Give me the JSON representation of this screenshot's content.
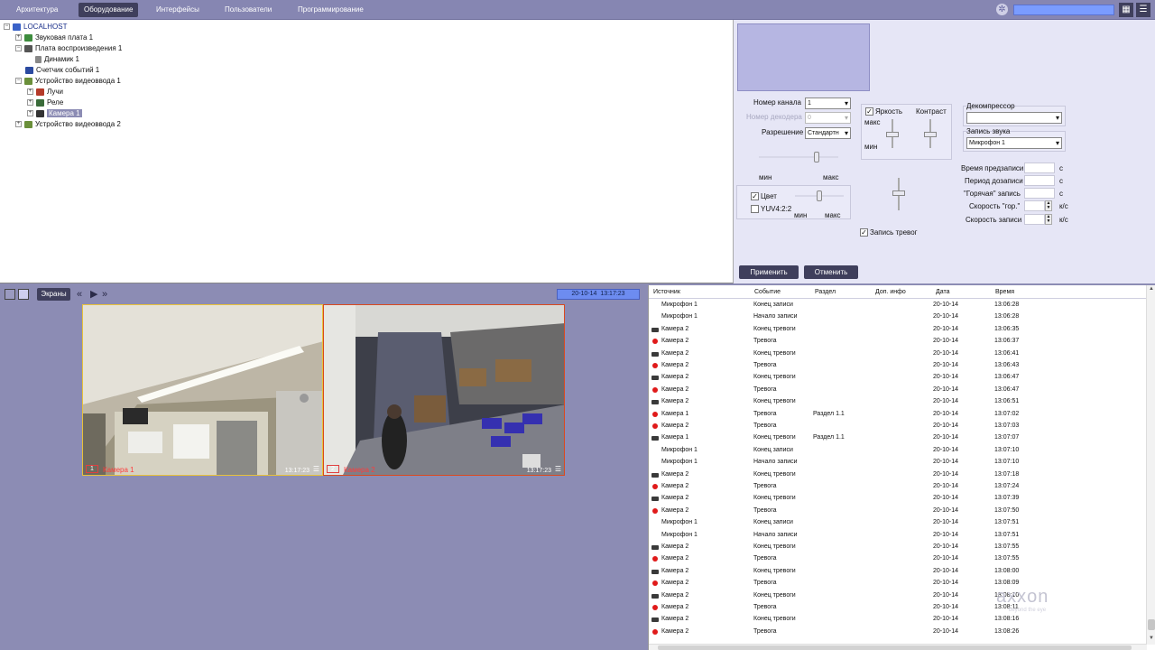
{
  "menu": {
    "tabs": [
      {
        "label": "Архитектура",
        "active": false
      },
      {
        "label": "Оборудование",
        "active": true
      },
      {
        "label": "Интерфейсы",
        "active": false
      },
      {
        "label": "Пользователи",
        "active": false
      },
      {
        "label": "Программирование",
        "active": false
      }
    ]
  },
  "tree": {
    "root": "LOCALHOST",
    "sound_card": "Звуковая плата 1",
    "playback_card": "Плата воспроизведения 1",
    "speaker": "Динамик 1",
    "event_counter": "Счетчик событий 1",
    "video_device_1": "Устройство видеоввода 1",
    "rays": "Лучи",
    "relay": "Реле",
    "camera": "Камера 1",
    "video_device_2": "Устройство видеоввода 2"
  },
  "settings": {
    "channel_label": "Номер канала",
    "channel_value": "1",
    "decoder_label": "Номер декодера",
    "decoder_value": "0",
    "resolution_label": "Разрешение",
    "resolution_value": "Стандартн",
    "min": "мин",
    "max": "макс",
    "brightness": "Яркость",
    "contrast": "Контраст",
    "color_label": "Цвет",
    "yuv_label": "YUV4:2:2",
    "alarm_record": "Запись тревог",
    "decompressor_label": "Декомпрессор",
    "decompressor_value": "",
    "sound_record_label": "Запись звука",
    "sound_record_value": "Микрофон 1",
    "prerecord_label": "Время предзаписи",
    "postrecord_label": "Период дозаписи",
    "hot_record_label": "\"Горячая\" запись",
    "hot_speed_label": "Скорость \"гор.\"",
    "record_speed_label": "Скорость записи",
    "unit_s": "с",
    "unit_fps": "к/с",
    "apply": "Применить",
    "cancel": "Отменить"
  },
  "layout_bar": {
    "screens": "Экраны",
    "date": "20-10-14",
    "time": "13:17:23"
  },
  "cameras": [
    {
      "num": "1",
      "name": "Камера 1",
      "time": "13:17:23",
      "border": "#e8c23a"
    },
    {
      "num": "2",
      "name": "Камера 2",
      "time": "13:17:23",
      "border": "#d94a1f"
    }
  ],
  "events": {
    "columns": [
      "Источник",
      "Событие",
      "Раздел",
      "Доп. инфо",
      "Дата",
      "Время"
    ],
    "rows": [
      {
        "icon": "none",
        "source": "Микрофон 1",
        "event": "Конец записи",
        "section": "",
        "date": "20-10-14",
        "time": "13:06:28"
      },
      {
        "icon": "none",
        "source": "Микрофон 1",
        "event": "Начало записи",
        "section": "",
        "date": "20-10-14",
        "time": "13:06:28"
      },
      {
        "icon": "camera",
        "source": "Камера 2",
        "event": "Конец тревоги",
        "section": "",
        "date": "20-10-14",
        "time": "13:06:35"
      },
      {
        "icon": "alarm",
        "source": "Камера 2",
        "event": "Тревога",
        "section": "",
        "date": "20-10-14",
        "time": "13:06:37"
      },
      {
        "icon": "camera",
        "source": "Камера 2",
        "event": "Конец тревоги",
        "section": "",
        "date": "20-10-14",
        "time": "13:06:41"
      },
      {
        "icon": "alarm",
        "source": "Камера 2",
        "event": "Тревога",
        "section": "",
        "date": "20-10-14",
        "time": "13:06:43"
      },
      {
        "icon": "camera",
        "source": "Камера 2",
        "event": "Конец тревоги",
        "section": "",
        "date": "20-10-14",
        "time": "13:06:47"
      },
      {
        "icon": "alarm",
        "source": "Камера 2",
        "event": "Тревога",
        "section": "",
        "date": "20-10-14",
        "time": "13:06:47"
      },
      {
        "icon": "camera",
        "source": "Камера 2",
        "event": "Конец тревоги",
        "section": "",
        "date": "20-10-14",
        "time": "13:06:51"
      },
      {
        "icon": "alarm",
        "source": "Камера 1",
        "event": "Тревога",
        "section": "Раздел 1.1",
        "date": "20-10-14",
        "time": "13:07:02"
      },
      {
        "icon": "alarm",
        "source": "Камера 2",
        "event": "Тревога",
        "section": "",
        "date": "20-10-14",
        "time": "13:07:03"
      },
      {
        "icon": "camera",
        "source": "Камера 1",
        "event": "Конец тревоги",
        "section": "Раздел 1.1",
        "date": "20-10-14",
        "time": "13:07:07"
      },
      {
        "icon": "none",
        "source": "Микрофон 1",
        "event": "Конец записи",
        "section": "",
        "date": "20-10-14",
        "time": "13:07:10"
      },
      {
        "icon": "none",
        "source": "Микрофон 1",
        "event": "Начало записи",
        "section": "",
        "date": "20-10-14",
        "time": "13:07:10"
      },
      {
        "icon": "camera",
        "source": "Камера 2",
        "event": "Конец тревоги",
        "section": "",
        "date": "20-10-14",
        "time": "13:07:18"
      },
      {
        "icon": "alarm",
        "source": "Камера 2",
        "event": "Тревога",
        "section": "",
        "date": "20-10-14",
        "time": "13:07:24"
      },
      {
        "icon": "camera",
        "source": "Камера 2",
        "event": "Конец тревоги",
        "section": "",
        "date": "20-10-14",
        "time": "13:07:39"
      },
      {
        "icon": "alarm",
        "source": "Камера 2",
        "event": "Тревога",
        "section": "",
        "date": "20-10-14",
        "time": "13:07:50"
      },
      {
        "icon": "none",
        "source": "Микрофон 1",
        "event": "Конец записи",
        "section": "",
        "date": "20-10-14",
        "time": "13:07:51"
      },
      {
        "icon": "none",
        "source": "Микрофон 1",
        "event": "Начало записи",
        "section": "",
        "date": "20-10-14",
        "time": "13:07:51"
      },
      {
        "icon": "camera",
        "source": "Камера 2",
        "event": "Конец тревоги",
        "section": "",
        "date": "20-10-14",
        "time": "13:07:55"
      },
      {
        "icon": "alarm",
        "source": "Камера 2",
        "event": "Тревога",
        "section": "",
        "date": "20-10-14",
        "time": "13:07:55"
      },
      {
        "icon": "camera",
        "source": "Камера 2",
        "event": "Конец тревоги",
        "section": "",
        "date": "20-10-14",
        "time": "13:08:00"
      },
      {
        "icon": "alarm",
        "source": "Камера 2",
        "event": "Тревога",
        "section": "",
        "date": "20-10-14",
        "time": "13:08:09"
      },
      {
        "icon": "camera",
        "source": "Камера 2",
        "event": "Конец тревоги",
        "section": "",
        "date": "20-10-14",
        "time": "13:08:10"
      },
      {
        "icon": "alarm",
        "source": "Камера 2",
        "event": "Тревога",
        "section": "",
        "date": "20-10-14",
        "time": "13:08:11"
      },
      {
        "icon": "camera",
        "source": "Камера 2",
        "event": "Конец тревоги",
        "section": "",
        "date": "20-10-14",
        "time": "13:08:16"
      },
      {
        "icon": "alarm",
        "source": "Камера 2",
        "event": "Тревога",
        "section": "",
        "date": "20-10-14",
        "time": "13:08:26"
      }
    ]
  },
  "watermark": {
    "brand": "axxon",
    "tagline": "beyond the eye"
  },
  "colors": {
    "accent": "#3f3f5c",
    "menu_bg": "#8686b2",
    "alarm": "#e01a1a",
    "date_box": "#6d8cf0"
  }
}
